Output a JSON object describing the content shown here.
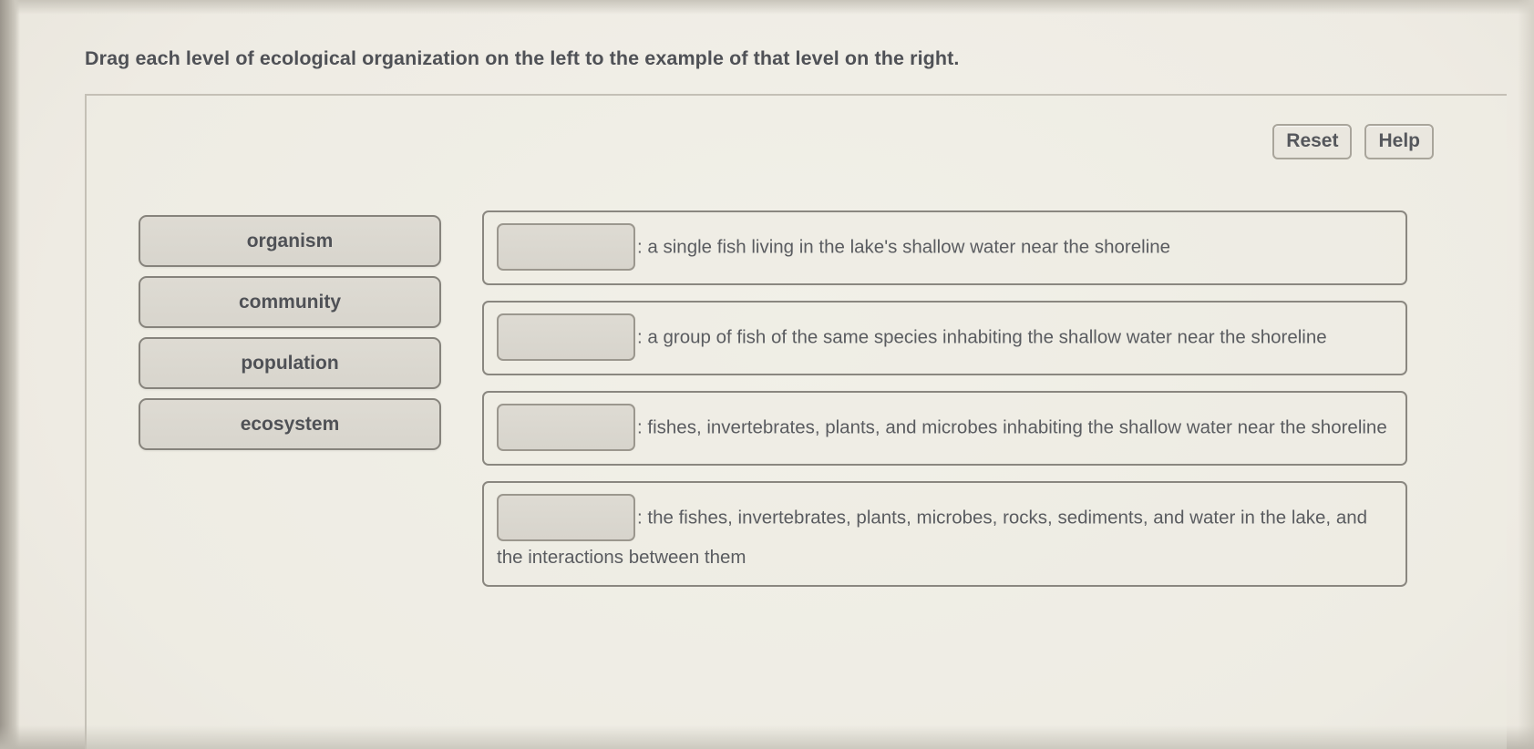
{
  "prompt": {
    "title": "Drag each level of ecological organization on the left to the example of that level on the right."
  },
  "toolbar": {
    "reset_label": "Reset",
    "help_label": "Help"
  },
  "drag_source": {
    "items": [
      {
        "label": "organism"
      },
      {
        "label": "community"
      },
      {
        "label": "population"
      },
      {
        "label": "ecosystem"
      }
    ]
  },
  "drop_targets": {
    "rows": [
      {
        "dropped_value": "",
        "text": ": a single fish living in the lake's shallow water near the shoreline"
      },
      {
        "dropped_value": "",
        "text": ": a group of fish of the same species inhabiting the shallow water near the shoreline"
      },
      {
        "dropped_value": "",
        "text": ": fishes, invertebrates, plants, and microbes inhabiting the shallow water near the shoreline"
      },
      {
        "dropped_value": "",
        "text": ": the fishes, invertebrates, plants, microbes, rocks, sediments, and water in the lake, and the interactions between them"
      }
    ]
  },
  "colors": {
    "page_background": "#eeebe3",
    "text": "#5a5c60",
    "title_text": "#4f5156",
    "tile_fill": "#dedbd3",
    "border": "#8a8780"
  }
}
